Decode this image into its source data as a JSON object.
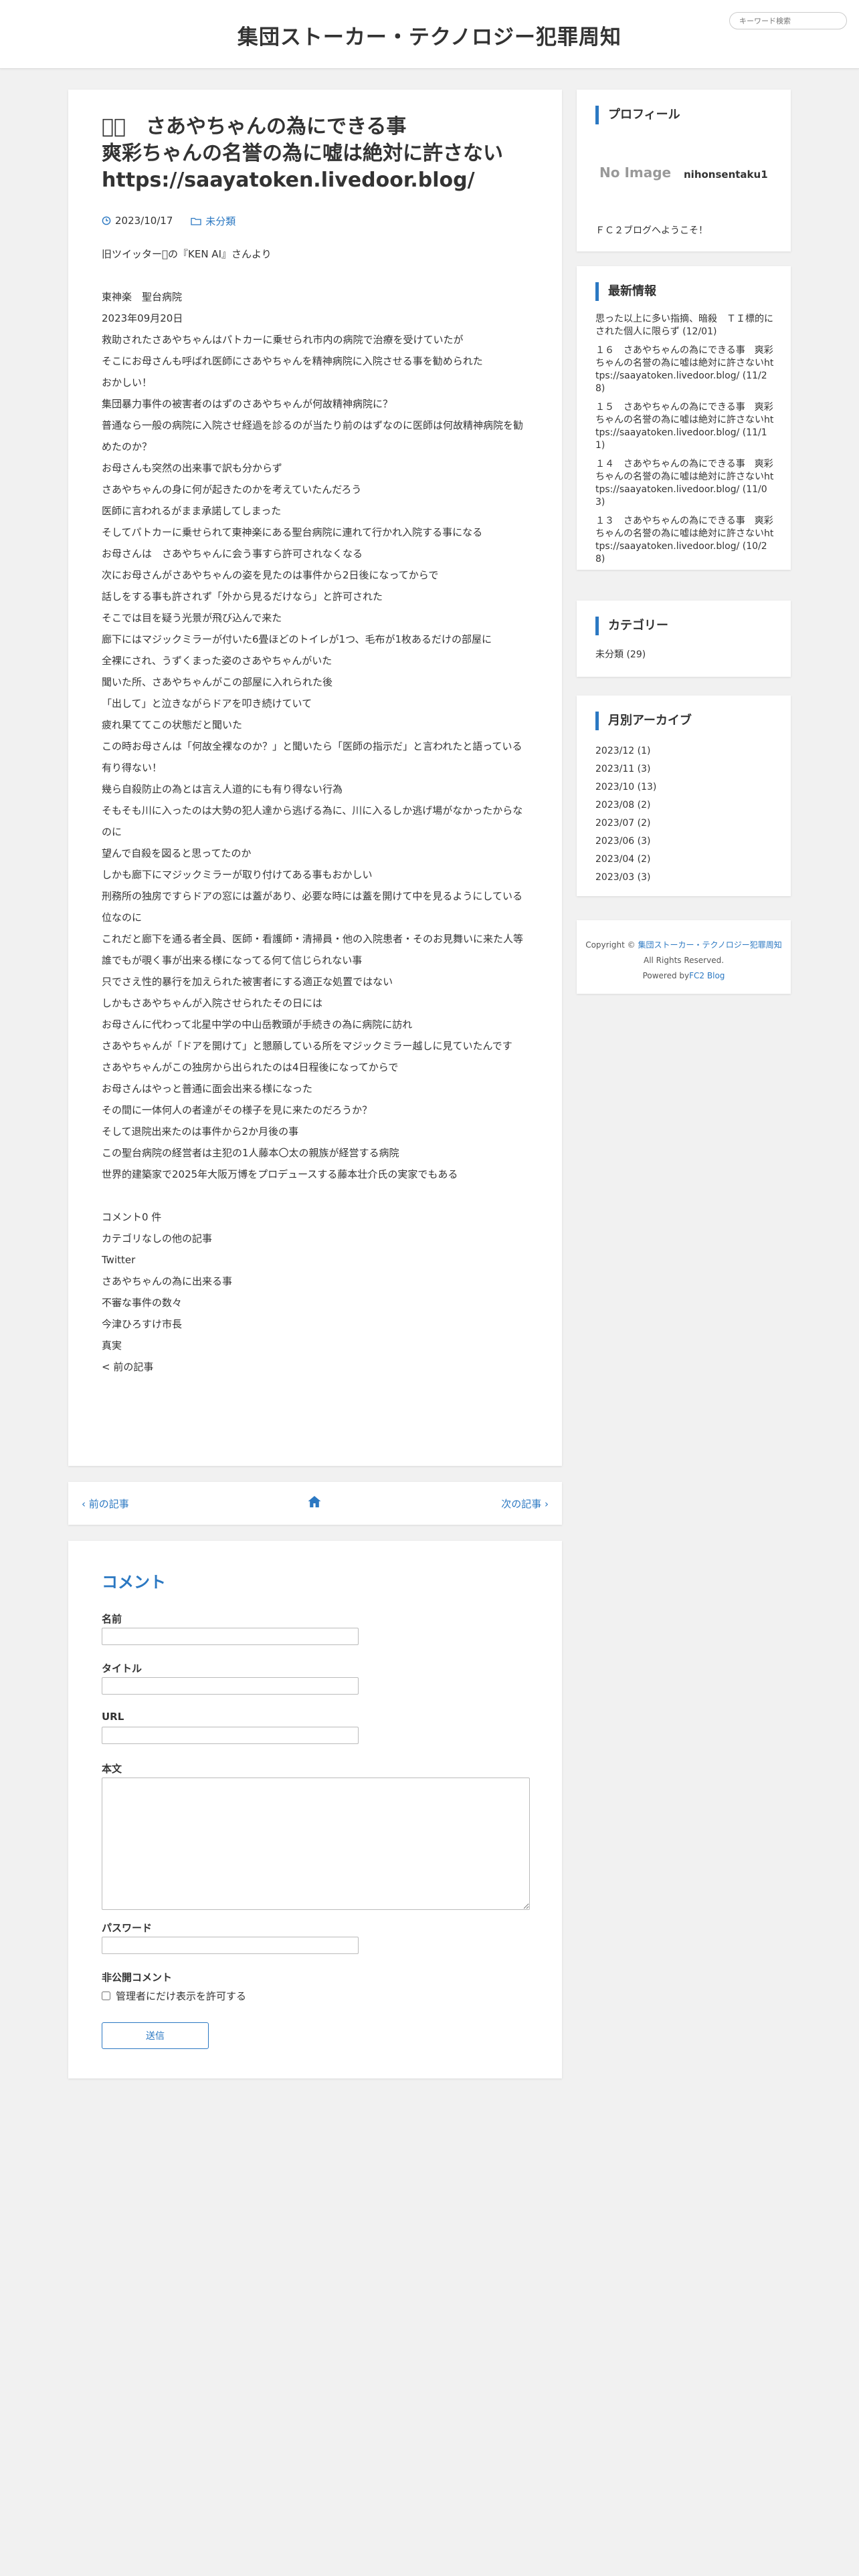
{
  "site": {
    "title": "集団ストーカー・テクノロジー犯罪周知",
    "search_placeholder": "キーワード検索"
  },
  "article": {
    "title_lines": [
      "󾠉󾠊　さあやちゃんの為にできる事",
      "爽彩ちゃんの名誉の為に嘘は絶対に許さない",
      "https://saayatoken.livedoor.blog/"
    ],
    "date": "2023/10/17",
    "category": "未分類",
    "body": [
      "旧ツイッター󾟵の『KEN AI』さんより",
      "",
      "東神楽　聖台病院",
      "2023年09月20日",
      "救助されたさあやちゃんはパトカーに乗せられ市内の病院で治療を受けていたが",
      "そこにお母さんも呼ばれ医師にさあやちゃんを精神病院に入院させる事を勧められた",
      "おかしい！",
      "集団暴力事件の被害者のはずのさあやちゃんが何故精神病院に？",
      "普通なら一般の病院に入院させ経過を診るのが当たり前のはずなのに医師は何故精神病院を勧めたのか？",
      "お母さんも突然の出来事で訳も分からず",
      "さあやちゃんの身に何が起きたのかを考えていたんだろう",
      "医師に言われるがまま承諾してしまった",
      "そしてパトカーに乗せられて東神楽にある聖台病院に連れて行かれ入院する事になる",
      "お母さんは　さあやちゃんに会う事すら許可されなくなる",
      "次にお母さんがさあやちゃんの姿を見たのは事件から2日後になってからで",
      "話しをする事も許されず「外から見るだけなら」と許可された",
      "そこでは目を疑う光景が飛び込んで来た",
      "廊下にはマジックミラーが付いた6畳ほどのトイレが1つ、毛布が1枚あるだけの部屋に",
      "全裸にされ、うずくまった姿のさあやちゃんがいた",
      "聞いた所、さあやちゃんがこの部屋に入れられた後",
      "「出して」と泣きながらドアを叩き続けていて",
      "疲れ果ててこの状態だと聞いた",
      "この時お母さんは「何故全裸なのか？」と聞いたら「医師の指示だ」と言われたと語っている",
      "有り得ない！",
      "幾ら自殺防止の為とは言え人道的にも有り得ない行為",
      "そもそも川に入ったのは大勢の犯人達から逃げる為に、川に入るしか逃げ場がなかったからなのに",
      "望んで自殺を図ると思ってたのか",
      "しかも廊下にマジックミラーが取り付けてある事もおかしい",
      "刑務所の独房ですらドアの窓には蓋があり、必要な時には蓋を開けて中を見るようにしている位なのに",
      "これだと廊下を通る者全員、医師・看護師・清掃員・他の入院患者・そのお見舞いに来た人等",
      "誰でもが覗く事が出来る様になってる何て信じられない事",
      "只でさえ性的暴行を加えられた被害者にする適正な処置ではない",
      "しかもさあやちゃんが入院させられたその日には",
      "お母さんに代わって北星中学の中山岳教頭が手続きの為に病院に訪れ",
      "さあやちゃんが「ドアを開けて」と懇願している所をマジックミラー越しに見ていたんです",
      "さあやちゃんがこの独房から出られたのは4日程後になってからで",
      "お母さんはやっと普通に面会出来る様になった",
      "その間に一体何人の者達がその様子を見に来たのだろうか？",
      "そして退院出来たのは事件から2か月後の事",
      "この聖台病院の経営者は主犯の1人藤本〇太の親族が経営する病院",
      "世界的建築家で2025年大阪万博をプロデュースする藤本壮介氏の実家でもある",
      "",
      "コメント0 件",
      "カテゴリなしの他の記事",
      "Twitter",
      "さあやちゃんの為に出来る事",
      "不審な事件の数々",
      "今津ひろすけ市長",
      "真実",
      "< 前の記事"
    ]
  },
  "nav": {
    "prev": "前の記事",
    "next": "次の記事"
  },
  "comment_form": {
    "heading": "コメント",
    "name_label": "名前",
    "title_label": "タイトル",
    "url_label": "URL",
    "body_label": "本文",
    "password_label": "パスワード",
    "secret_label": "非公開コメント",
    "secret_checkbox": "管理者にだけ表示を許可する",
    "submit": "送信"
  },
  "sidebar": {
    "profile": {
      "heading": "プロフィール",
      "no_image": "No Image",
      "name": "nihonsentaku1",
      "description": "ＦＣ２ブログへようこそ！"
    },
    "latest": {
      "heading": "最新情報",
      "items": [
        "思った以上に多い指摘、暗殺　ＴＩ標的にされた個人に限らず (12/01)",
        "１６　さあやちゃんの為にできる事　爽彩ちゃんの名誉の為に嘘は絶対に許さないhttps://saayatoken.livedoor.blog/ (11/28)",
        "１５　さあやちゃんの為にできる事　爽彩ちゃんの名誉の為に嘘は絶対に許さないhttps://saayatoken.livedoor.blog/ (11/11)",
        "１４　さあやちゃんの為にできる事　爽彩ちゃんの名誉の為に嘘は絶対に許さないhttps://saayatoken.livedoor.blog/ (11/03)",
        "１３　さあやちゃんの為にできる事　爽彩ちゃんの名誉の為に嘘は絶対に許さないhttps://saayatoken.livedoor.blog/ (10/28)"
      ]
    },
    "category": {
      "heading": "カテゴリー",
      "items": [
        "未分類 (29)"
      ]
    },
    "archive": {
      "heading": "月別アーカイブ",
      "items": [
        "2023/12 (1)",
        "2023/11 (3)",
        "2023/10 (13)",
        "2023/08 (2)",
        "2023/07 (2)",
        "2023/06 (3)",
        "2023/04 (2)",
        "2023/03 (3)"
      ]
    },
    "copyright": {
      "prefix": "Copyright ©",
      "site": "集団ストーカー・テクノロジー犯罪周知",
      "rights": "All Rights Reserved.",
      "powered_prefix": "Powered by",
      "powered_link": "FC2 Blog"
    }
  },
  "colors": {
    "accent": "#2b78c2",
    "background": "#f1f1f1",
    "card": "#ffffff"
  },
  "icons": {
    "date": "clock-icon",
    "category": "folder-icon",
    "home": "home-icon",
    "prev": "chevron-left-icon",
    "next": "chevron-right-icon"
  }
}
